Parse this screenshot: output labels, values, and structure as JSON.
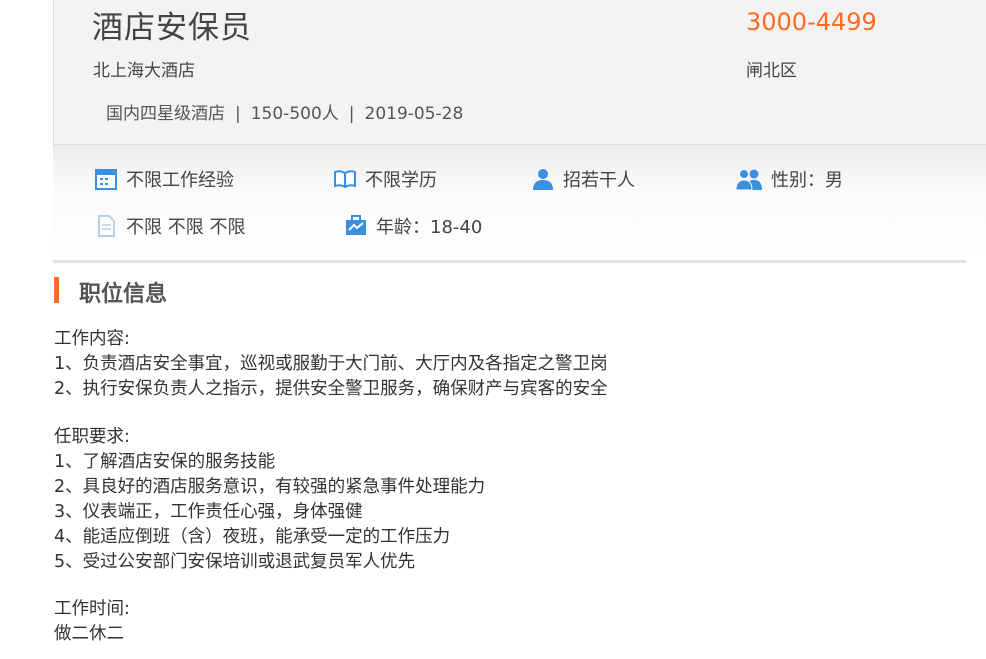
{
  "job": {
    "title": "酒店安保员",
    "salary": "3000-4499",
    "company": "北上海大酒店",
    "district": "闸北区",
    "company_type": "国内四星级酒店",
    "company_size": "150-500人",
    "date": "2019-05-28",
    "separator": "|"
  },
  "requirements": {
    "experience": "不限工作经验",
    "education": "不限学历",
    "headcount": "招若干人",
    "gender": "性别：男",
    "other": "不限 不限 不限",
    "age": "年龄：18-40"
  },
  "icons": {
    "experience": "calendar-icon",
    "education": "book-icon",
    "headcount": "person-icon",
    "gender": "people-icon",
    "other": "document-icon",
    "age": "briefcase-icon"
  },
  "colors": {
    "accent": "#ff6a1f",
    "icon_blue": "#3b8fe0"
  },
  "section": {
    "title": "职位信息",
    "content_heading": "工作内容:",
    "content_items": [
      "1、负责酒店安全事宜，巡视或服勤于大门前、大厅内及各指定之警卫岗",
      "2、执行安保负责人之指示，提供安全警卫服务，确保财产与宾客的安全"
    ],
    "requirements_heading": "任职要求:",
    "requirements_items": [
      "1、了解酒店安保的服务技能",
      "2、具良好的酒店服务意识，有较强的紧急事件处理能力",
      "3、仪表端正，工作责任心强，身体强健",
      "4、能适应倒班（含）夜班，能承受一定的工作压力",
      "5、受过公安部门安保培训或退武复员军人优先"
    ],
    "hours_heading": "工作时间:",
    "hours_value": "做二休二"
  }
}
